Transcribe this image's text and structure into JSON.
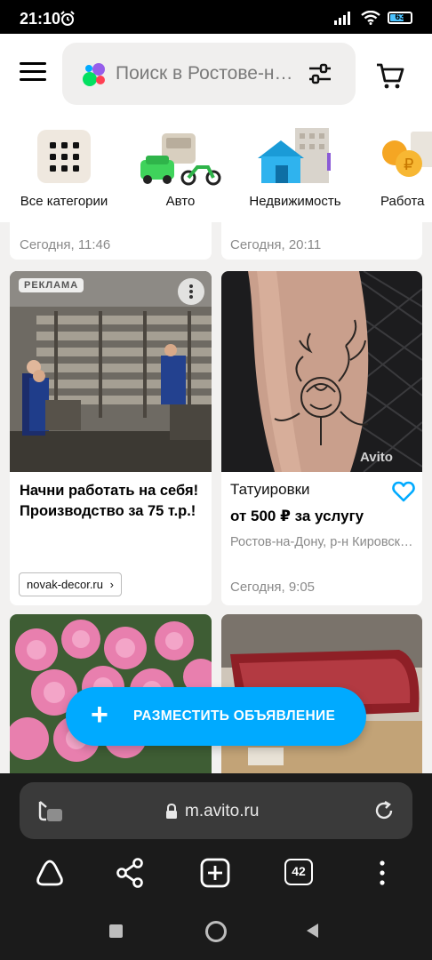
{
  "status_bar": {
    "time": "21:10",
    "battery": "63"
  },
  "header": {
    "search_placeholder": "Поиск в Ростове-на-Дону"
  },
  "categories": [
    {
      "label": "Все категории",
      "icon": "grid-icon"
    },
    {
      "label": "Авто",
      "icon": "cars-icon"
    },
    {
      "label": "Недвижимость",
      "icon": "house-icon"
    },
    {
      "label": "Работа",
      "icon": "coins-icon"
    }
  ],
  "feed": {
    "top_dates": [
      "Сегодня, 11:46",
      "Сегодня, 20:11"
    ],
    "ad_card": {
      "badge": "РЕКЛАМА",
      "title": "Начни работать на себя! Производство за 75 т.р.!",
      "link": "novak-decor.ru"
    },
    "tattoo_card": {
      "title": "Татуировки",
      "price": "от 500 ₽ за услугу",
      "location": "Ростов-на-Дону, р-н Кировский",
      "date": "Сегодня, 9:05",
      "watermark": "Avito"
    }
  },
  "fab": {
    "label": "РАЗМЕСТИТЬ ОБЪЯВЛЕНИЕ"
  },
  "browser": {
    "url": "m.avito.ru",
    "tab_count": "42"
  },
  "colors": {
    "accent": "#00aaff",
    "favorite": "#00aaff"
  }
}
